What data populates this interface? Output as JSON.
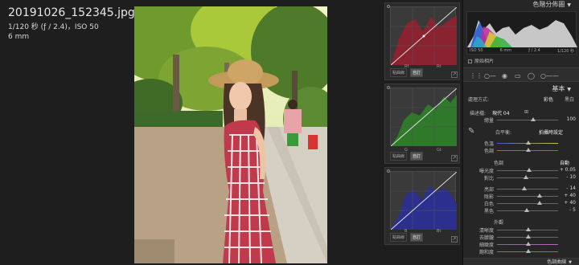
{
  "image_info": {
    "filename": "20191026_152345.jpg",
    "exposure": "1/120 秒 (ƒ / 2.4)，ISO 50",
    "focal": "6 mm"
  },
  "curve_panels": [
    {
      "channel": "red",
      "buttons": [
        "點曲線",
        "自訂"
      ],
      "labels": [
        "Rf",
        "Rt"
      ]
    },
    {
      "channel": "green",
      "buttons": [
        "點曲線",
        "自訂"
      ],
      "labels": [
        "G",
        "Gt"
      ]
    },
    {
      "channel": "blue",
      "buttons": [
        "點曲線",
        "自訂"
      ],
      "labels": [
        "B",
        "Bt"
      ]
    }
  ],
  "right_panel": {
    "histogram_title": "色階分佈圖",
    "histogram_meta": [
      "ISO 50",
      "6 mm",
      "ƒ / 2.4",
      "1/120 秒"
    ],
    "original_photo": "原始相片",
    "basic_title": "基本",
    "treatment": {
      "label": "處理方式:",
      "color": "彩色",
      "bw": "黑白"
    },
    "profile": {
      "label": "描述檔:",
      "value": "現代 04"
    },
    "amount": {
      "label": "總量",
      "value": "100"
    },
    "wb": {
      "label": "白平衡:",
      "value": "拍攝時設定"
    },
    "temp": {
      "label": "色溫"
    },
    "tint": {
      "label": "色調"
    },
    "tone_title": "色調",
    "auto": "自動",
    "exposure": {
      "label": "曝光度",
      "value": "+ 0.05"
    },
    "contrast": {
      "label": "對比",
      "value": "- 10"
    },
    "highlights": {
      "label": "亮部",
      "value": "- 14"
    },
    "shadows": {
      "label": "陰影",
      "value": "+ 40"
    },
    "whites": {
      "label": "白色",
      "value": "+ 40"
    },
    "blacks": {
      "label": "黑色",
      "value": "- 5"
    },
    "presence_title": "外觀",
    "texture": {
      "label": "清晰度"
    },
    "clarity": {
      "label": "去朦朧"
    },
    "vibrance": {
      "label": "細緻度"
    },
    "saturation": {
      "label": "飽和度"
    },
    "tone_curve": "色調曲線"
  },
  "colors": {
    "red_hist": "#8a2230",
    "green_hist": "#2f7a2a",
    "blue_hist": "#2c2f8e"
  }
}
